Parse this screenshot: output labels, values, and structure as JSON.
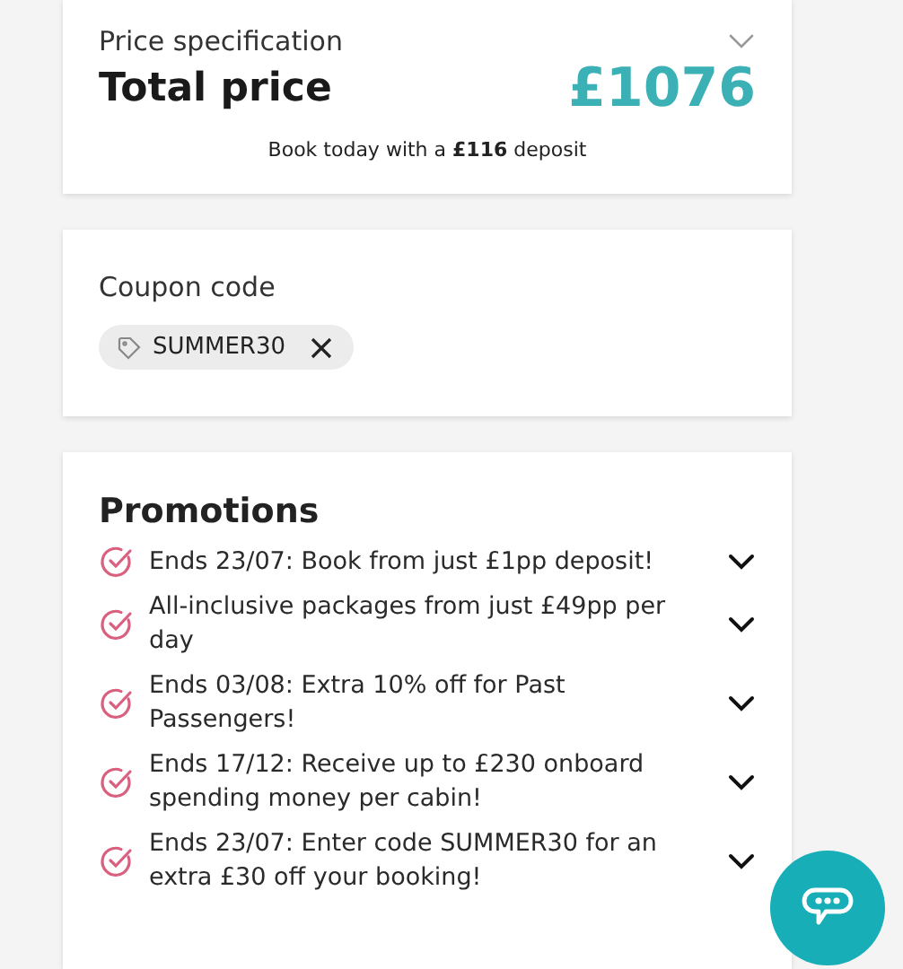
{
  "price": {
    "label": "Price specification",
    "title": "Total price",
    "amount": "£1076",
    "note": "Book today with a **£116** deposit"
  },
  "coupon": {
    "label": "Coupon code",
    "code": "SUMMER30"
  },
  "promotions": {
    "title": "Promotions",
    "items": [
      {
        "text": "Ends 23/07: Book from just £1pp deposit!"
      },
      {
        "text": "All-inclusive packages from just £49pp per day"
      },
      {
        "text": "Ends 03/08: Extra 10% off for Past Passengers!"
      },
      {
        "text": "Ends 17/12: Receive up to £230 onboard spending money per cabin!"
      },
      {
        "text": "Ends 23/07: Enter code SUMMER30 for an extra £30 off your booking!"
      }
    ]
  }
}
